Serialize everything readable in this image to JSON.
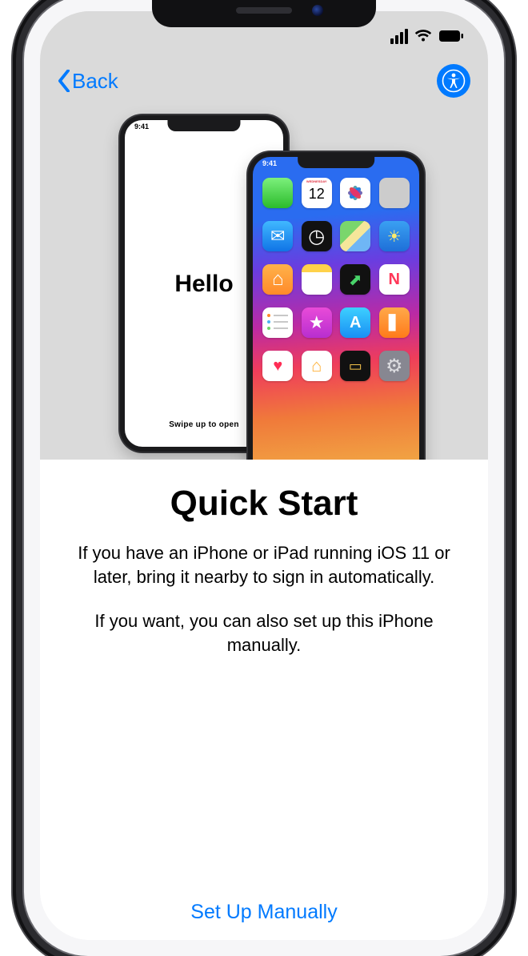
{
  "nav": {
    "back_label": "Back"
  },
  "illustration": {
    "left_phone": {
      "greeting": "Hello",
      "swipe_hint": "Swipe up to open",
      "time": "9:41"
    },
    "right_phone": {
      "time": "9:41",
      "calendar_day_label": "WEDNESDAY",
      "calendar_day_number": "12"
    }
  },
  "content": {
    "title": "Quick Start",
    "body1": "If you have an iPhone or iPad running iOS 11 or later, bring it nearby to sign in automatically.",
    "body2": "If you want, you can also set up this iPhone manually."
  },
  "actions": {
    "manual_setup": "Set Up Manually"
  },
  "colors": {
    "link": "#007aff",
    "hero_bg": "#dadada"
  }
}
